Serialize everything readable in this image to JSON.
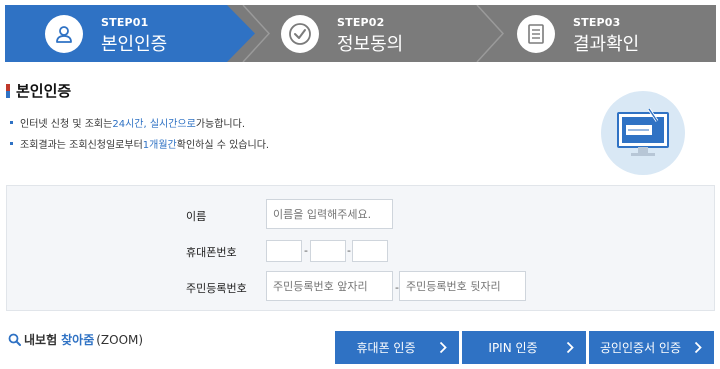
{
  "steps": [
    {
      "num": "STEP01",
      "label": "본인인증",
      "icon": "user-icon",
      "active": true
    },
    {
      "num": "STEP02",
      "label": "정보동의",
      "icon": "check-circle-icon",
      "active": false
    },
    {
      "num": "STEP03",
      "label": "결과확인",
      "icon": "document-icon",
      "active": false
    }
  ],
  "section": {
    "title": "본인인증",
    "notice1": {
      "pre": "인터넷 신청 및 조회는 ",
      "hl": "24시간, 실시간으로",
      "post": " 가능합니다."
    },
    "notice2": {
      "pre": "조회결과는 조회신청일로부터 ",
      "hl": "1개월간",
      "post": " 확인하실 수 있습니다."
    }
  },
  "form": {
    "name_label": "이름",
    "name_placeholder": "이름을 입력해주세요.",
    "phone_label": "휴대폰번호",
    "rrn_label": "주민등록번호",
    "rrn_front_placeholder": "주민등록번호 앞자리",
    "rrn_back_placeholder": "주민등록번호 뒷자리",
    "sep": "-"
  },
  "zoom": {
    "bold": "내보험",
    "find": "찾아줌",
    "tail": "(ZOOM)"
  },
  "buttons": {
    "phone": "휴대폰 인증",
    "ipin": "IPIN 인증",
    "cert": "공인인증서 인증"
  },
  "colors": {
    "accent": "#2f72c4",
    "step_inactive": "#7b7b7b"
  }
}
